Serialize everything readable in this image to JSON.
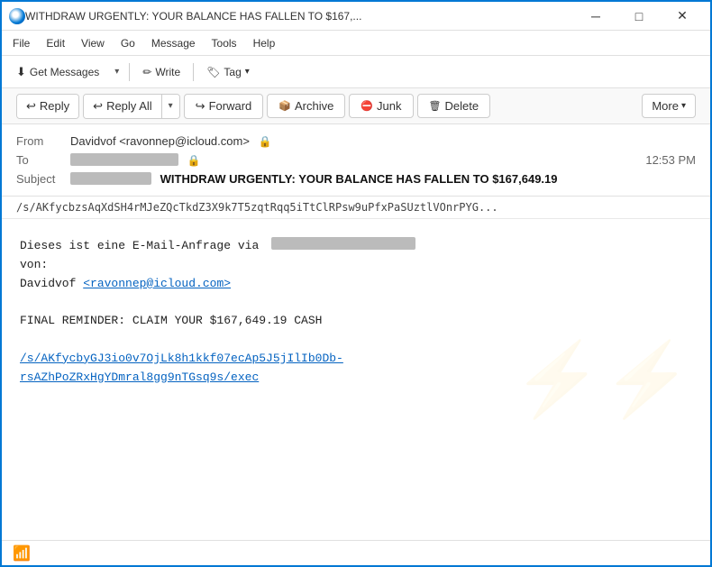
{
  "window": {
    "title": "WITHDRAW URGENTLY: YOUR BALANCE HAS FALLEN TO $167,...",
    "controls": {
      "minimize": "─",
      "maximize": "□",
      "close": "✕"
    }
  },
  "menu": {
    "items": [
      "File",
      "Edit",
      "View",
      "Go",
      "Message",
      "Tools",
      "Help"
    ]
  },
  "toolbar1": {
    "get_messages": "Get Messages",
    "write": "Write",
    "tag": "Tag"
  },
  "toolbar2": {
    "reply": "Reply",
    "reply_all": "Reply All",
    "forward": "Forward",
    "archive": "Archive",
    "junk": "Junk",
    "delete": "Delete",
    "more": "More"
  },
  "email": {
    "from_label": "From",
    "from_value": "Davidvof <ravonnep@icloud.com>",
    "to_label": "To",
    "to_value_blurred": "██████████████",
    "time": "12:53 PM",
    "subject_label": "Subject",
    "subject_prefix_blurred": "████████████",
    "subject_main": "WITHDRAW URGENTLY: YOUR BALANCE HAS FALLEN TO $167,649.19",
    "url_bar": "/s/AKfycbzsAqXdSH4rMJeZQcTkdZ3X9k7T5zqtRqq5iTtClRPsw9uPfxPaSUztlVOnrPYG...",
    "body_line1": "Dieses ist eine E-Mail-Anfrage via",
    "body_blurred": "██████████████████",
    "body_line2": "von:",
    "body_line3_prefix": "Davidvof ",
    "body_link1": "<ravonnep@icloud.com>",
    "body_empty": "",
    "body_reminder": "FINAL REMINDER: CLAIM YOUR $167,649.19 CASH",
    "body_link2_line1": "/s/AKfycbyGJ3io0v7OjLk8h1kkf07ecAp5J5jIlIb0Db-",
    "body_link2_line2": "rsAZhPoZRxHgYDmral8gg9nTGsq9s/exec"
  },
  "status": {
    "wifi_icon": "wifi",
    "text": ""
  }
}
